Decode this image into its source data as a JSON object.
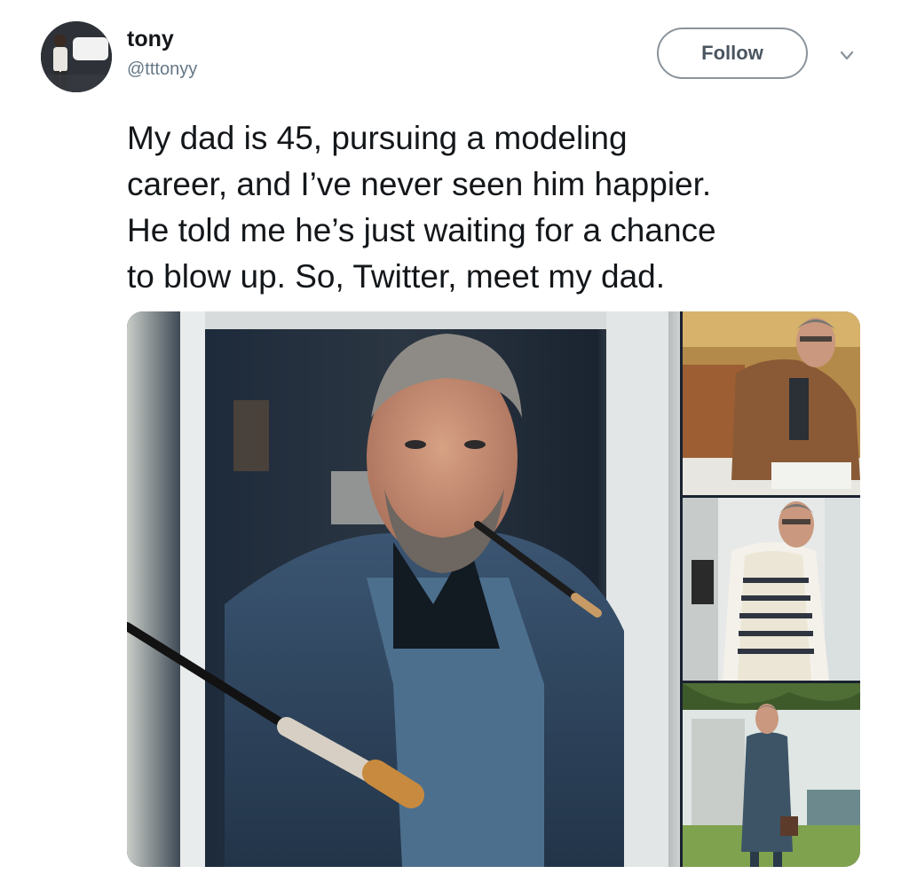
{
  "user": {
    "name": "tony",
    "handle": "@tttonyy"
  },
  "header": {
    "follow_label": "Follow",
    "caret_icon": "chevron-down-icon"
  },
  "tweet": {
    "text_lines": [
      "My dad is 45, pursuing a modeling",
      "career, and I’ve never seen him happier.",
      "He told me he’s just waiting for a chance",
      "to blow up. So, Twitter, meet my dad."
    ]
  },
  "media": {
    "count": 4
  },
  "colors": {
    "text": "#14171a",
    "secondary_text": "#657786",
    "follow_border": "#8a939b",
    "background": "#ffffff"
  }
}
